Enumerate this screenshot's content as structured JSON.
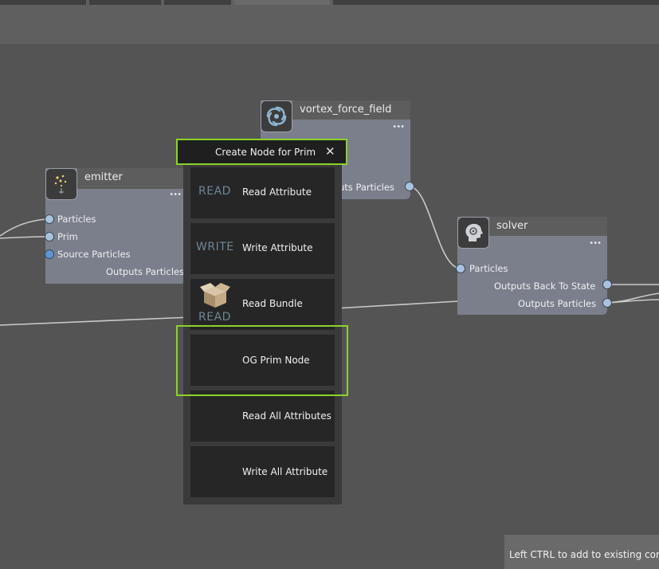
{
  "popup": {
    "title": "Create Node for Prim",
    "items": [
      {
        "icon_text": "READ",
        "label": "Read Attribute"
      },
      {
        "icon_text": "WRITE",
        "label": "Write Attribute"
      },
      {
        "icon_text": "READ",
        "icon_name": "box-icon",
        "label": "Read Bundle"
      },
      {
        "icon_text": "",
        "label": "OG Prim Node"
      },
      {
        "icon_text": "",
        "label": "Read All Attributes"
      },
      {
        "icon_text": "",
        "label": "Write All Attribute"
      }
    ]
  },
  "nodes": {
    "emitter": {
      "title": "emitter",
      "icon": "sparkle-emitter-icon",
      "inputs": [
        "Particles",
        "Prim",
        "Source Particles"
      ],
      "outputs": [
        "Outputs Particles"
      ]
    },
    "vortex": {
      "title": "vortex_force_field",
      "icon": "vortex-icon",
      "outputs": [
        "Outputs Particles"
      ],
      "outputs_partial": "uts Particles"
    },
    "solver": {
      "title": "solver",
      "icon": "brain-gear-icon",
      "inputs": [
        "Particles"
      ],
      "outputs": [
        "Outputs Back To State",
        "Outputs Particles"
      ]
    }
  },
  "menu_dots": "•••",
  "tooltip": "Left CTRL to add to existing conn",
  "colors": {
    "highlight": "#8cd22a",
    "node_body": "#7b7f8b",
    "port": "#a9c3df"
  }
}
